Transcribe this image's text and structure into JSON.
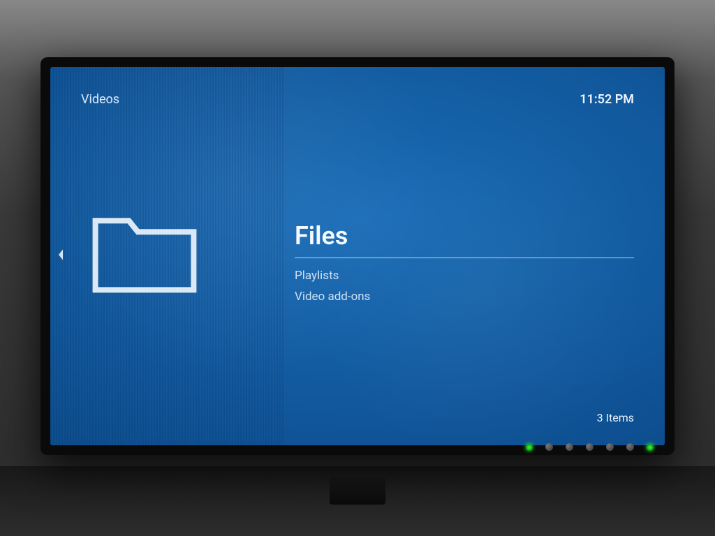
{
  "header": {
    "section": "Videos",
    "time": "11:52 PM"
  },
  "menu": {
    "items": [
      {
        "label": "Files",
        "selected": true
      },
      {
        "label": "Playlists",
        "selected": false
      },
      {
        "label": "Video add-ons",
        "selected": false
      }
    ]
  },
  "footer": {
    "item_count": "3 Items"
  },
  "icons": {
    "left_panel": "folder-icon",
    "back": "chevron-left-icon"
  },
  "colors": {
    "background_primary": "#0d4e8f",
    "background_highlight": "#1a6db8",
    "text_primary": "#eaf4ff",
    "text_secondary": "#cfe0f2"
  }
}
